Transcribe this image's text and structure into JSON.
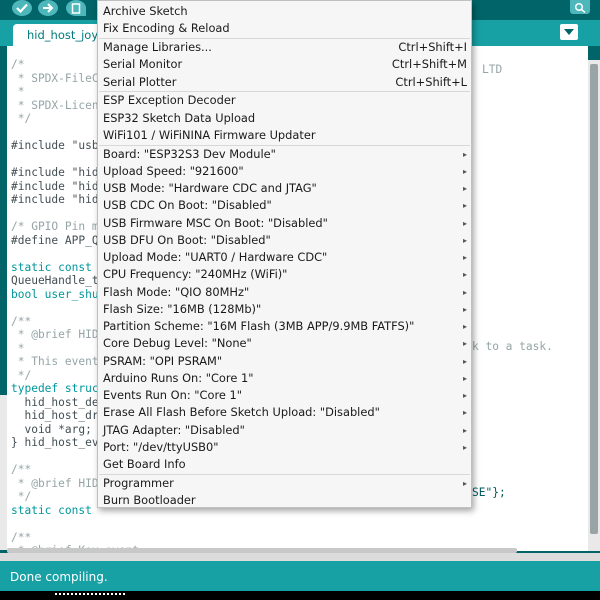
{
  "toolbar": {
    "buttons": [
      {
        "name": "verify-button",
        "icon": "checkmark-icon"
      },
      {
        "name": "upload-button",
        "icon": "arrow-right-icon"
      },
      {
        "name": "new-button",
        "icon": "document-icon"
      }
    ],
    "serial_monitor_icon": "magnifier-icon"
  },
  "tabs": {
    "active": "hid_host_joys",
    "menu_icon": "triangle-down-icon"
  },
  "colors": {
    "toolbar_bg": "#006468",
    "tabbar_bg": "#17a1a5",
    "button_bg": "#4db7bb",
    "menu_bg": "#f6f6f6",
    "status_bg": "#17a1a5",
    "console_bg": "#000000"
  },
  "code": [
    {
      "text": "/*",
      "cls": "c-comment"
    },
    {
      "text": " * SPDX-FileC",
      "cls": "c-comment"
    },
    {
      "text": " *",
      "cls": "c-comment"
    },
    {
      "text": " * SPDX-Licen",
      "cls": "c-comment"
    },
    {
      "text": " */",
      "cls": "c-comment"
    },
    {
      "text": "",
      "cls": ""
    },
    {
      "text": "#include \"usb",
      "cls": ""
    },
    {
      "text": "",
      "cls": ""
    },
    {
      "text": "#include \"hid",
      "cls": ""
    },
    {
      "text": "#include \"hid",
      "cls": ""
    },
    {
      "text": "#include \"hid",
      "cls": ""
    },
    {
      "text": "",
      "cls": ""
    },
    {
      "text": "/* GPIO Pin m",
      "cls": "c-comment"
    },
    {
      "text": "#define APP_Q",
      "cls": ""
    },
    {
      "text": "",
      "cls": ""
    },
    {
      "text": "static const",
      "cls": "c-kw"
    },
    {
      "text": "QueueHandle_t",
      "cls": ""
    },
    {
      "text": "bool user_shu",
      "cls": "c-type"
    },
    {
      "text": "",
      "cls": ""
    },
    {
      "text": "/**",
      "cls": "c-comment"
    },
    {
      "text": " * @brief HID",
      "cls": "c-comment"
    },
    {
      "text": " *",
      "cls": "c-comment"
    },
    {
      "text": " * This event",
      "cls": "c-comment"
    },
    {
      "text": " */",
      "cls": "c-comment"
    },
    {
      "text": "typedef struc",
      "cls": "c-kw"
    },
    {
      "text": "  hid_host_de",
      "cls": ""
    },
    {
      "text": "  hid_host_dr",
      "cls": ""
    },
    {
      "text": "  void *arg;",
      "cls": ""
    },
    {
      "text": "} hid_host_ev",
      "cls": ""
    },
    {
      "text": "",
      "cls": ""
    },
    {
      "text": "/**",
      "cls": "c-comment"
    },
    {
      "text": " * @brief HID",
      "cls": "c-comment"
    },
    {
      "text": " */",
      "cls": "c-comment"
    },
    {
      "text": "static const",
      "cls": "c-kw"
    },
    {
      "text": "",
      "cls": ""
    },
    {
      "text": "/**",
      "cls": "c-comment"
    },
    {
      "text": " * @brief Key event",
      "cls": "c-comment"
    },
    {
      "text": " */",
      "cls": "c-comment"
    }
  ],
  "code_fragments": {
    "ltd": "LTD",
    "task": "k to a task.",
    "se": "SE\"};"
  },
  "menu": {
    "items": [
      {
        "label": "Archive Sketch",
        "shortcut": "",
        "submenu": false
      },
      {
        "label": "Fix Encoding & Reload",
        "shortcut": "",
        "submenu": false
      },
      {
        "label": "Manage Libraries...",
        "shortcut": "Ctrl+Shift+I",
        "submenu": false
      },
      {
        "label": "Serial Monitor",
        "shortcut": "Ctrl+Shift+M",
        "submenu": false
      },
      {
        "label": "Serial Plotter",
        "shortcut": "Ctrl+Shift+L",
        "submenu": false
      },
      {
        "label": "ESP Exception Decoder",
        "shortcut": "",
        "submenu": false
      },
      {
        "label": "ESP32 Sketch Data Upload",
        "shortcut": "",
        "submenu": false
      },
      {
        "label": "WiFi101 / WiFiNINA Firmware Updater",
        "shortcut": "",
        "submenu": false
      },
      {
        "label": "Board: \"ESP32S3 Dev Module\"",
        "shortcut": "",
        "submenu": true
      },
      {
        "label": "Upload Speed: \"921600\"",
        "shortcut": "",
        "submenu": true
      },
      {
        "label": "USB Mode: \"Hardware CDC and JTAG\"",
        "shortcut": "",
        "submenu": true
      },
      {
        "label": "USB CDC On Boot: \"Disabled\"",
        "shortcut": "",
        "submenu": true
      },
      {
        "label": "USB Firmware MSC On Boot: \"Disabled\"",
        "shortcut": "",
        "submenu": true
      },
      {
        "label": "USB DFU On Boot: \"Disabled\"",
        "shortcut": "",
        "submenu": true
      },
      {
        "label": "Upload Mode: \"UART0 / Hardware CDC\"",
        "shortcut": "",
        "submenu": true
      },
      {
        "label": "CPU Frequency: \"240MHz (WiFi)\"",
        "shortcut": "",
        "submenu": true
      },
      {
        "label": "Flash Mode: \"QIO 80MHz\"",
        "shortcut": "",
        "submenu": true
      },
      {
        "label": "Flash Size: \"16MB (128Mb)\"",
        "shortcut": "",
        "submenu": true
      },
      {
        "label": "Partition Scheme: \"16M Flash (3MB APP/9.9MB FATFS)\"",
        "shortcut": "",
        "submenu": true
      },
      {
        "label": "Core Debug Level: \"None\"",
        "shortcut": "",
        "submenu": true
      },
      {
        "label": "PSRAM: \"OPI PSRAM\"",
        "shortcut": "",
        "submenu": true
      },
      {
        "label": "Arduino Runs On: \"Core 1\"",
        "shortcut": "",
        "submenu": true
      },
      {
        "label": "Events Run On: \"Core 1\"",
        "shortcut": "",
        "submenu": true
      },
      {
        "label": "Erase All Flash Before Sketch Upload: \"Disabled\"",
        "shortcut": "",
        "submenu": true
      },
      {
        "label": "JTAG Adapter: \"Disabled\"",
        "shortcut": "",
        "submenu": true
      },
      {
        "label": "Port: \"/dev/ttyUSB0\"",
        "shortcut": "",
        "submenu": true
      },
      {
        "label": "Get Board Info",
        "shortcut": "",
        "submenu": false
      },
      {
        "label": "Programmer",
        "shortcut": "",
        "submenu": true
      },
      {
        "label": "Burn Bootloader",
        "shortcut": "",
        "submenu": false
      }
    ],
    "submenu_arrow": "▸"
  },
  "status": {
    "message": "Done compiling."
  }
}
